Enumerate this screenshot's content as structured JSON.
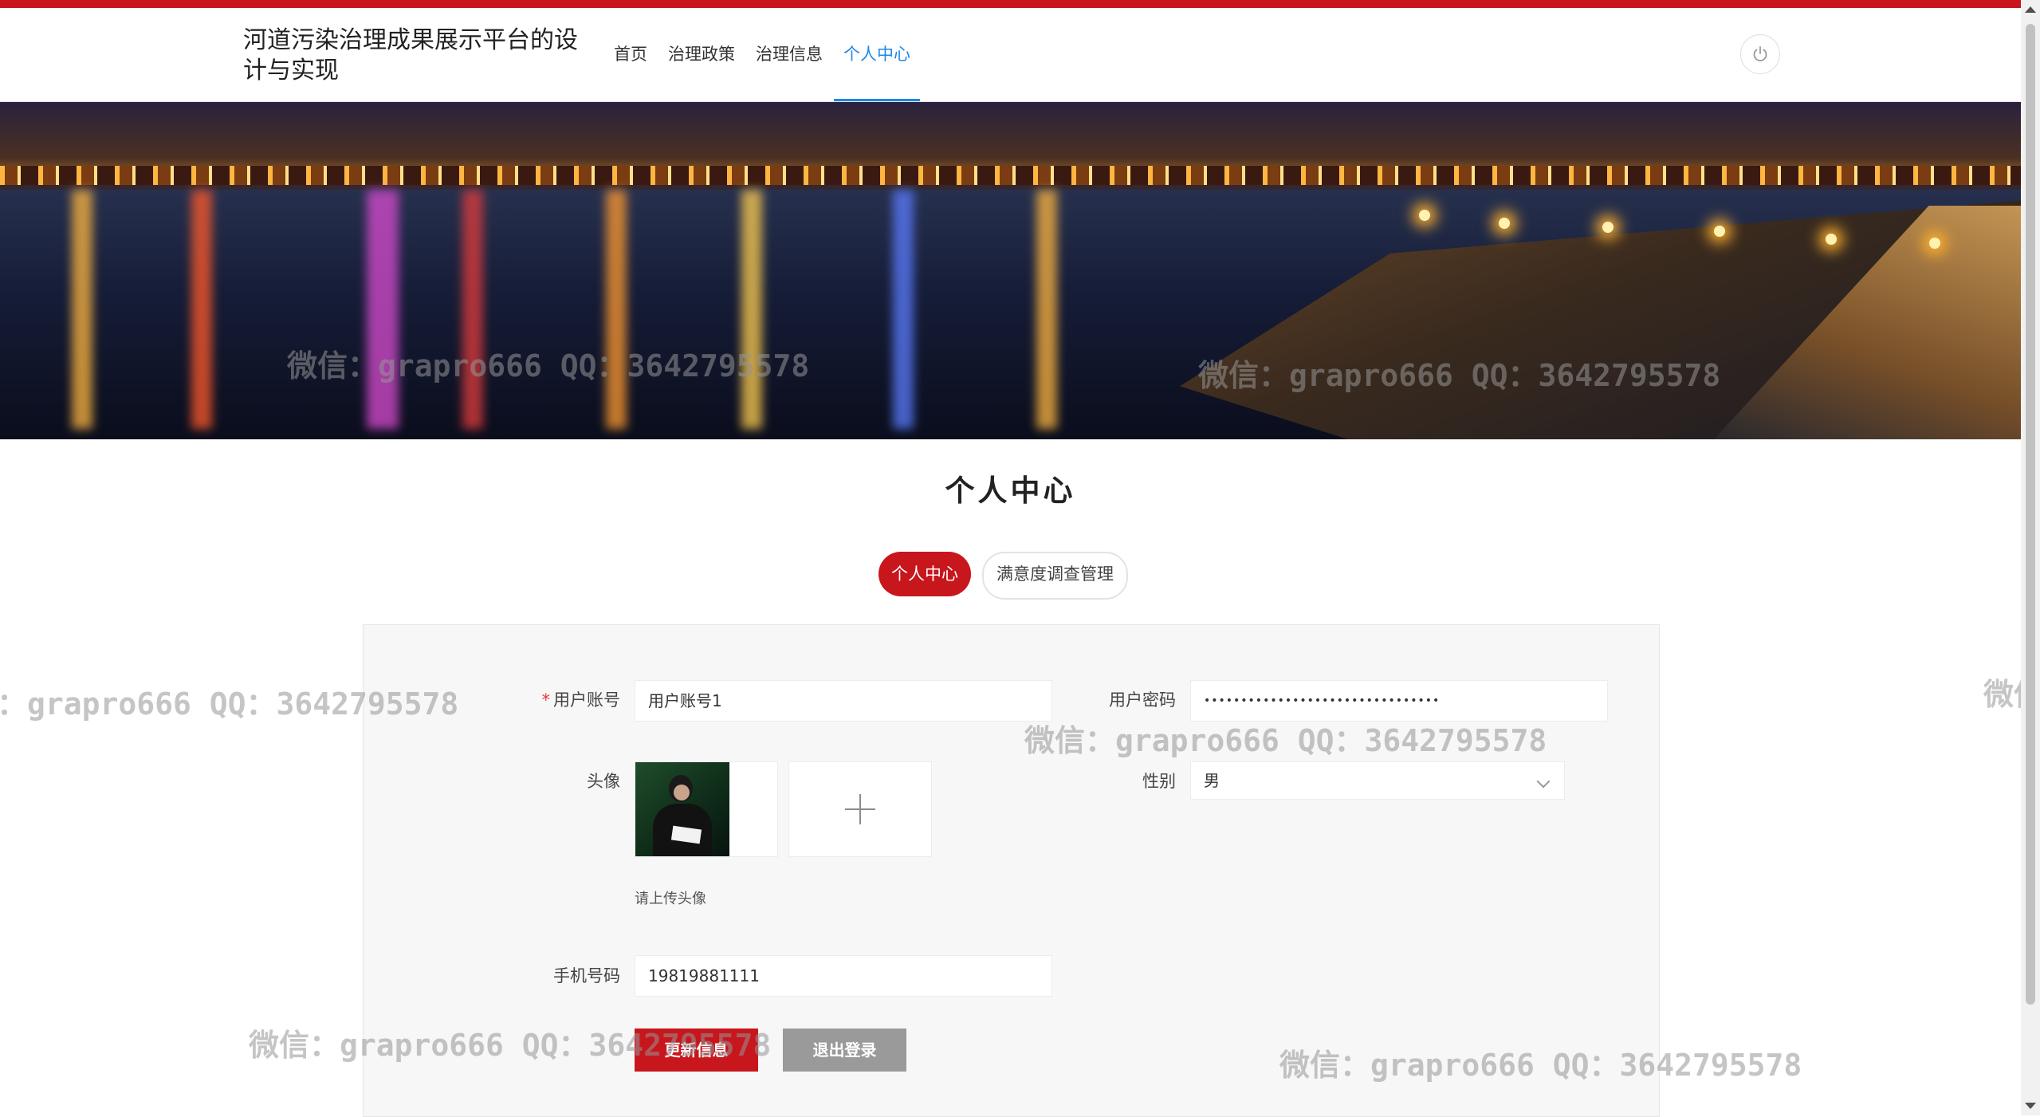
{
  "header": {
    "site_title": "河道污染治理成果展示平台的设计与实现",
    "nav": [
      {
        "label": "首页",
        "active": false
      },
      {
        "label": "治理政策",
        "active": false
      },
      {
        "label": "治理信息",
        "active": false
      },
      {
        "label": "个人中心",
        "active": true
      }
    ],
    "power_icon": "power-icon"
  },
  "watermark_text": "微信：grapro666 QQ：3642795578",
  "watermark_partial_left": "：grapro666 QQ：3642795578",
  "watermark_partial_right": "微信",
  "page_title": "个人中心",
  "tabs": [
    {
      "label": "个人中心",
      "active": true
    },
    {
      "label": "满意度调查管理",
      "active": false
    }
  ],
  "form": {
    "account_label": "用户账号",
    "account_value": "用户账号1",
    "password_label": "用户密码",
    "password_value": "••••••••••••••••••••••••••••••••",
    "avatar_label": "头像",
    "avatar_hint": "请上传头像",
    "gender_label": "性别",
    "gender_value": "男",
    "phone_label": "手机号码",
    "phone_value": "19819881111",
    "update_button": "更新信息",
    "logout_button": "退出登录"
  },
  "colors": {
    "brand_red": "#c8161d",
    "nav_active": "#1e88e5"
  }
}
